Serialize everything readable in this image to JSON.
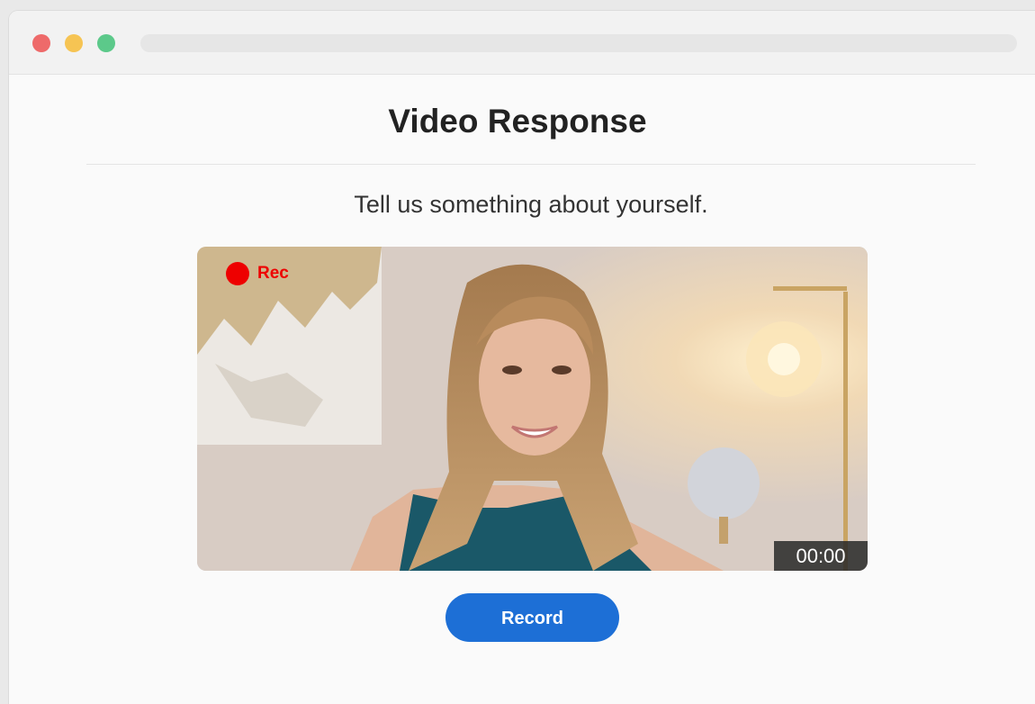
{
  "page": {
    "title": "Video Response",
    "prompt": "Tell us something about yourself."
  },
  "video": {
    "rec_label": "Rec",
    "timer": "00:00",
    "rec_color": "#ee0000"
  },
  "actions": {
    "record_label": "Record",
    "accent": "#1d6fd6"
  },
  "window": {
    "controls": [
      "close",
      "minimize",
      "maximize"
    ]
  }
}
